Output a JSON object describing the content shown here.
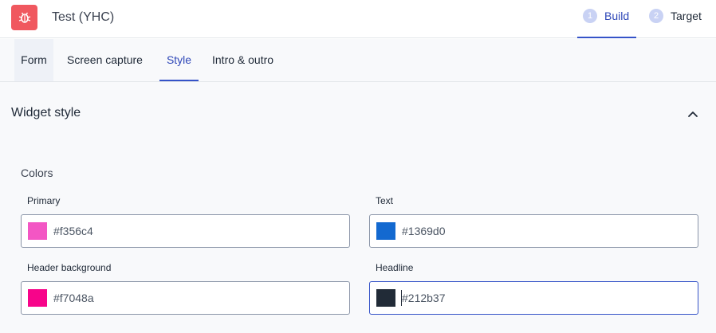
{
  "app": {
    "title": "Test (YHC)",
    "logo_icon": "bug-icon",
    "logo_color": "#f0585f"
  },
  "steps": [
    {
      "number": "1",
      "label": "Build",
      "active": true
    },
    {
      "number": "2",
      "label": "Target",
      "active": false
    }
  ],
  "tabs": [
    {
      "label": "Form"
    },
    {
      "label": "Screen capture"
    },
    {
      "label": "Style",
      "active": true
    },
    {
      "label": "Intro & outro"
    }
  ],
  "section": {
    "title": "Widget style",
    "toggle_icon": "chevron-up-icon"
  },
  "colors": {
    "label": "Colors",
    "fields": [
      {
        "label": "Primary",
        "value": "#f356c4",
        "swatch": "#f356c4"
      },
      {
        "label": "Text",
        "value": "#1369d0",
        "swatch": "#1369d0"
      },
      {
        "label": "Header background",
        "value": "#f7048a",
        "swatch": "#f7048a"
      },
      {
        "label": "Headline",
        "value": "#212b37",
        "swatch": "#212b37",
        "focused": true
      }
    ]
  },
  "accent_color": "#3553c8"
}
